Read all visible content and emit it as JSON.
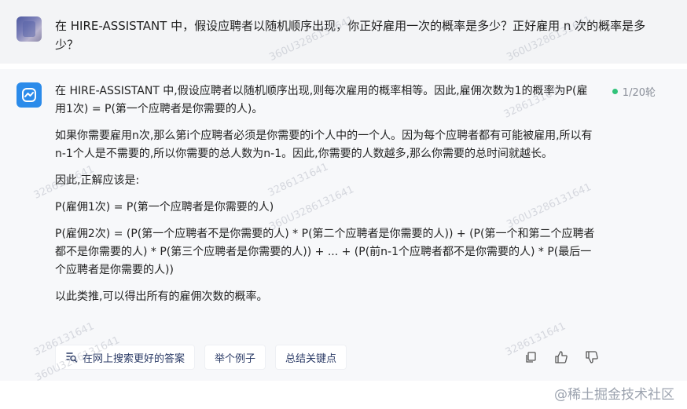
{
  "user": {
    "question": "在 HIRE-ASSISTANT 中，假设应聘者以随机顺序出现，你正好雇用一次的概率是多少？正好雇用 n 次的概率是多少？"
  },
  "assistant": {
    "round_label": "1/20轮",
    "paragraphs": [
      "在 HIRE-ASSISTANT 中,假设应聘者以随机顺序出现,则每次雇用的概率相等。因此,雇佣次数为1的概率为P(雇用1次) = P(第一个应聘者是你需要的人)。",
      "如果你需要雇用n次,那么第i个应聘者必须是你需要的i个人中的一个人。因为每个应聘者都有可能被雇用,所以有n-1个人是不需要的,所以你需要的总人数为n-1。因此,你需要的人数越多,那么你需要的总时间就越长。",
      "因此,正解应该是:",
      "P(雇佣1次) = P(第一个应聘者是你需要的人)",
      "P(雇佣2次) = (P(第一个应聘者不是你需要的人) * P(第二个应聘者是你需要的人)) + (P(第一个和第二个应聘者都不是你需要的人) * P(第三个应聘者是你需要的人)) + ... + (P(前n-1个应聘者都不是你需要的人) * P(最后一个应聘者是你需要的人))",
      "以此类推,可以得出所有的雇佣次数的概率。"
    ],
    "actions": {
      "search_web": "在网上搜索更好的答案",
      "example": "举个例子",
      "summarize": "总结关键点"
    }
  },
  "watermarks": {
    "a": "360U3286131641",
    "b": "3286131641"
  },
  "footer": {
    "brand": "@稀土掘金技术社区"
  },
  "colors": {
    "user_bg": "#f3f4f6",
    "bot_bg": "#f7f8fa",
    "accent": "#2b8bea",
    "status_green": "#32c37a"
  },
  "icons": [
    "search-icon",
    "copy-icon",
    "thumbs-up-icon",
    "thumbs-down-icon"
  ]
}
